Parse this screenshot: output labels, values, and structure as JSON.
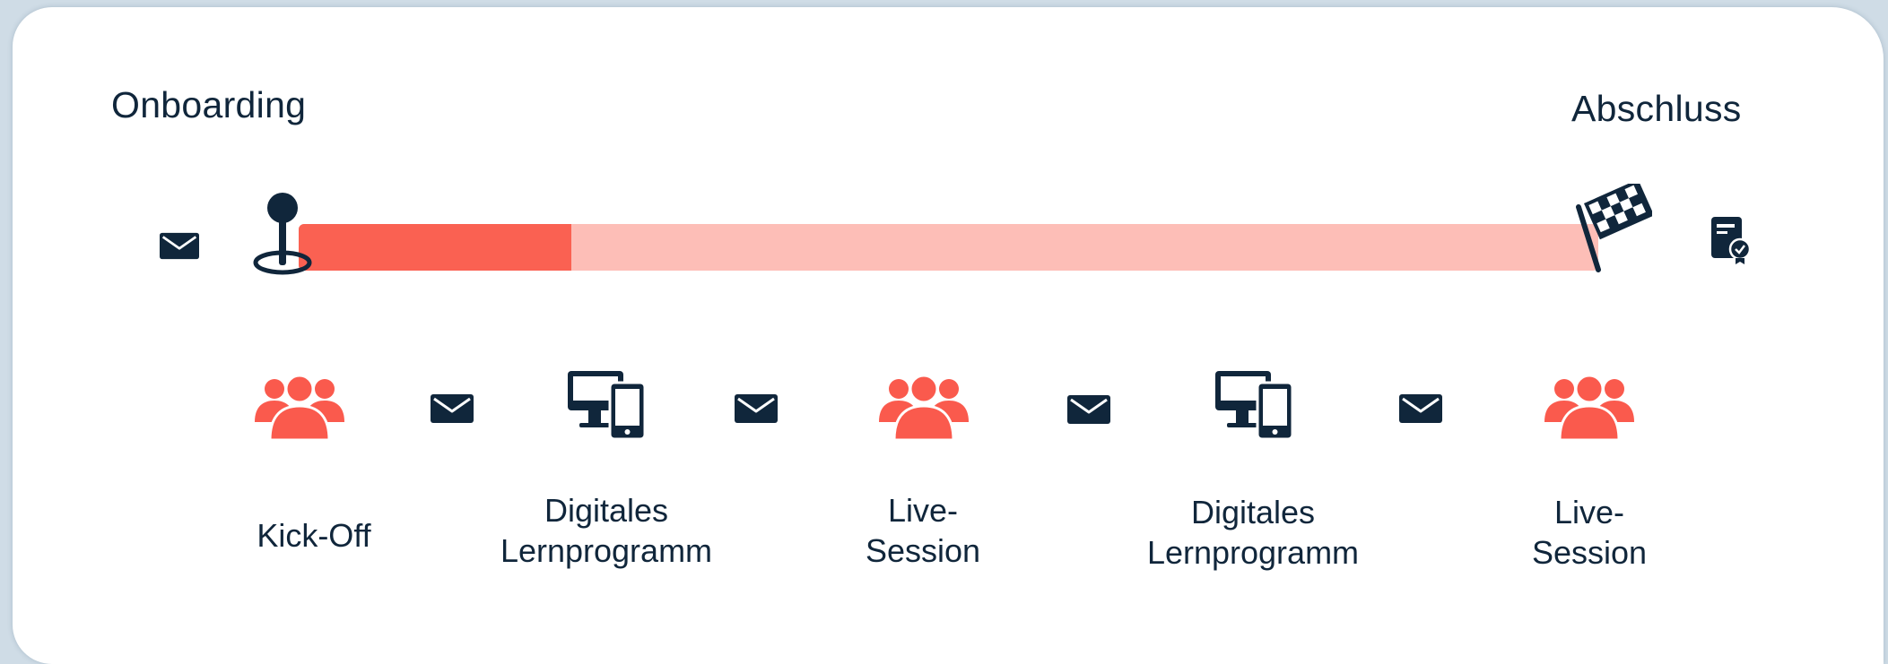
{
  "headings": {
    "start": "Onboarding",
    "end": "Abschluss"
  },
  "progress": {
    "filled_fraction": 0.21
  },
  "colors": {
    "accent": "#FA6152",
    "accent_light": "#FDBEB7",
    "navy": "#10263B",
    "card": "#FFFFFF"
  },
  "icons": {
    "top_row": [
      "mail-icon",
      "location-pin-icon",
      "checkered-flag-icon",
      "certificate-icon"
    ],
    "step_row": [
      "group-icon",
      "mail-icon",
      "devices-icon",
      "mail-icon",
      "group-icon",
      "mail-icon",
      "devices-icon",
      "mail-icon",
      "group-icon"
    ]
  },
  "steps": [
    {
      "icon": "group-icon",
      "label": "Kick-Off"
    },
    {
      "icon": "devices-icon",
      "label": "Digitales\nLernprogramm"
    },
    {
      "icon": "group-icon",
      "label": "Live-\nSession"
    },
    {
      "icon": "devices-icon",
      "label": "Digitales\nLernprogramm"
    },
    {
      "icon": "group-icon",
      "label": "Live-\nSession"
    }
  ]
}
